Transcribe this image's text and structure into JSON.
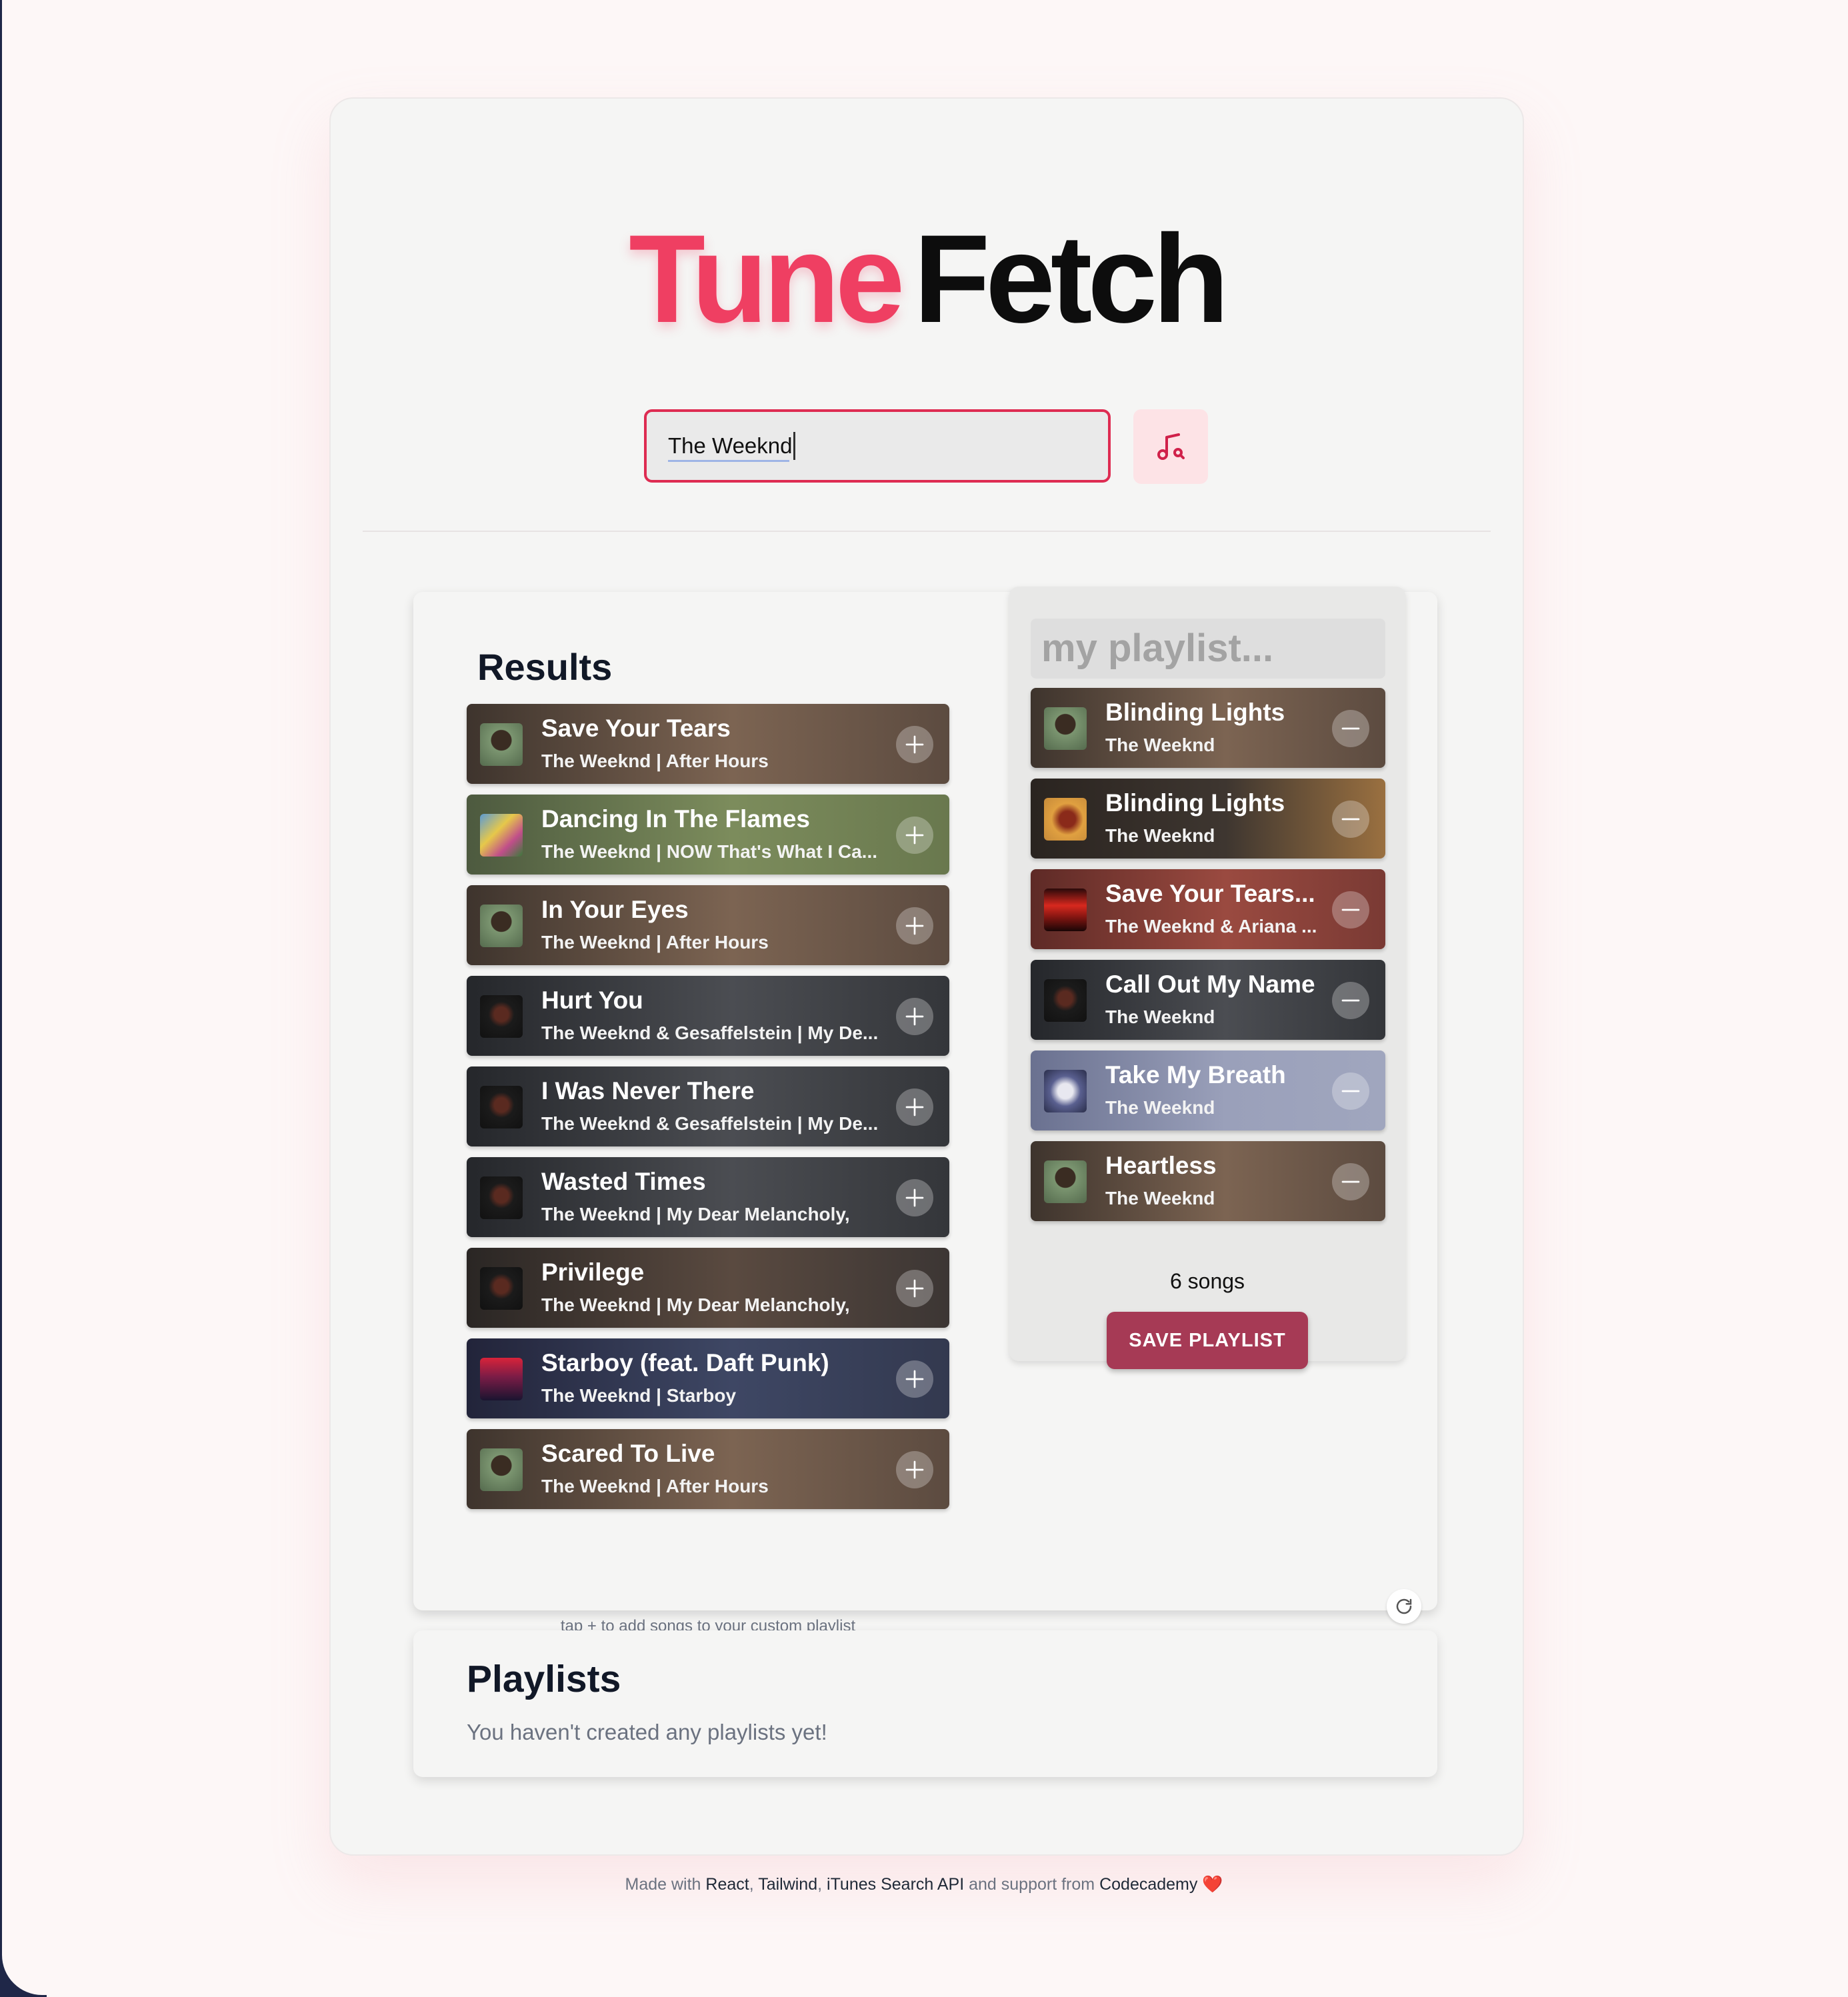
{
  "app": {
    "logo_part1": "Tune",
    "logo_part2": "Fetch",
    "brand_color": "#ef3f62",
    "accent_color": "#a63a55"
  },
  "search": {
    "value": "The Weeknd",
    "button_icon": "music-search-icon"
  },
  "results": {
    "title": "Results",
    "hint": "tap + to add songs to your custom playlist",
    "action_icon": "plus-icon",
    "items": [
      {
        "title": "Save Your Tears",
        "subtitle": "The Weeknd | After Hours"
      },
      {
        "title": "Dancing In The Flames",
        "subtitle": "The Weeknd | NOW That's What I Ca..."
      },
      {
        "title": "In Your Eyes",
        "subtitle": "The Weeknd | After Hours"
      },
      {
        "title": "Hurt You",
        "subtitle": "The Weeknd & Gesaffelstein | My De..."
      },
      {
        "title": "I Was Never There",
        "subtitle": "The Weeknd & Gesaffelstein | My De..."
      },
      {
        "title": "Wasted Times",
        "subtitle": "The Weeknd | My Dear Melancholy,"
      },
      {
        "title": "Privilege",
        "subtitle": "The Weeknd | My Dear Melancholy,"
      },
      {
        "title": "Starboy (feat. Daft Punk)",
        "subtitle": "The Weeknd | Starboy"
      },
      {
        "title": "Scared To Live",
        "subtitle": "The Weeknd | After Hours"
      }
    ]
  },
  "playlist": {
    "name_placeholder": "my playlist...",
    "action_icon": "minus-icon",
    "items": [
      {
        "title": "Blinding Lights",
        "subtitle": "The Weeknd"
      },
      {
        "title": "Blinding Lights",
        "subtitle": "The Weeknd"
      },
      {
        "title": "Save Your Tears...",
        "subtitle": "The Weeknd & Ariana ..."
      },
      {
        "title": "Call Out My Name",
        "subtitle": "The Weeknd"
      },
      {
        "title": "Take My Breath",
        "subtitle": "The Weeknd"
      },
      {
        "title": "Heartless",
        "subtitle": "The Weeknd"
      }
    ],
    "count": "6 songs",
    "save_label": "SAVE PLAYLIST",
    "refresh_icon": "refresh-icon"
  },
  "playlists": {
    "title": "Playlists",
    "empty": "You haven't created any playlists yet!"
  },
  "footer": {
    "made_with": "Made with",
    "react": "React",
    "sep1": ",",
    "tailwind": "Tailwind",
    "sep2": ",",
    "itunes": "iTunes Search API",
    "and_support": "and support from",
    "codecademy": "Codecademy",
    "heart": "❤️"
  }
}
